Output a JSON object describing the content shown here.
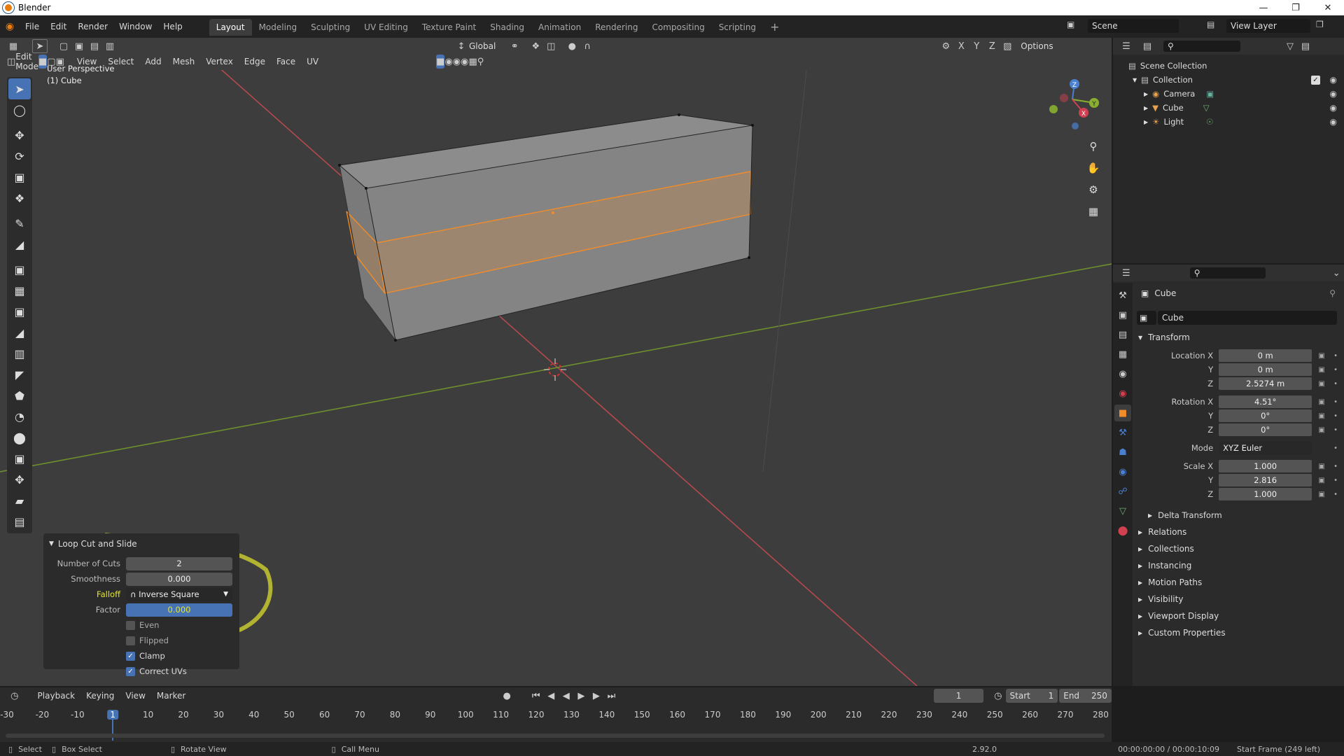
{
  "window": {
    "title": "Blender"
  },
  "menu": [
    "File",
    "Edit",
    "Render",
    "Window",
    "Help"
  ],
  "workspaces": [
    "Layout",
    "Modeling",
    "Sculpting",
    "UV Editing",
    "Texture Paint",
    "Shading",
    "Animation",
    "Rendering",
    "Compositing",
    "Scripting"
  ],
  "active_workspace": "Layout",
  "scene": {
    "label": "Scene",
    "view_layer": "View Layer"
  },
  "viewport": {
    "orientation": "Global",
    "mode": "Edit Mode",
    "menus": [
      "View",
      "Select",
      "Add",
      "Mesh",
      "Vertex",
      "Edge",
      "Face",
      "UV"
    ],
    "options_label": "Options",
    "perspective_label": "User Perspective",
    "object_label": "(1) Cube",
    "gizmo": {
      "x": "X",
      "y": "Y",
      "z": "Z"
    },
    "axis_toggles": [
      "X",
      "Y",
      "Z"
    ]
  },
  "operator_panel": {
    "title": "Loop Cut and Slide",
    "number_of_cuts": {
      "label": "Number of Cuts",
      "value": "2"
    },
    "smoothness": {
      "label": "Smoothness",
      "value": "0.000"
    },
    "falloff": {
      "label": "Falloff",
      "value": "Inverse Square"
    },
    "factor": {
      "label": "Factor",
      "value": "0.000"
    },
    "checkboxes": [
      {
        "label": "Even",
        "checked": false
      },
      {
        "label": "Flipped",
        "checked": false
      },
      {
        "label": "Clamp",
        "checked": true
      },
      {
        "label": "Correct UVs",
        "checked": true
      }
    ]
  },
  "outliner": {
    "root": "Scene Collection",
    "collection": "Collection",
    "items": [
      {
        "label": "Camera",
        "icon": "camera-icon",
        "color": "#e9a24b"
      },
      {
        "label": "Cube",
        "icon": "mesh-icon",
        "color": "#e9a24b"
      },
      {
        "label": "Light",
        "icon": "light-icon",
        "color": "#e9a24b"
      }
    ]
  },
  "properties": {
    "object_name": "Cube",
    "data_name": "Cube",
    "transform_label": "Transform",
    "location": {
      "label": "Location X",
      "x": "0 m",
      "y": "0 m",
      "z": "2.5274 m"
    },
    "rotation": {
      "label": "Rotation X",
      "x": "4.51°",
      "y": "0°",
      "z": "0°"
    },
    "mode": {
      "label": "Mode",
      "value": "XYZ Euler"
    },
    "scale": {
      "label": "Scale X",
      "x": "1.000",
      "y": "2.816",
      "z": "1.000"
    },
    "axis_y": "Y",
    "axis_z": "Z",
    "delta_transform": "Delta Transform",
    "sections": [
      "Relations",
      "Collections",
      "Instancing",
      "Motion Paths",
      "Visibility",
      "Viewport Display",
      "Custom Properties"
    ]
  },
  "timeline": {
    "menus": [
      "Playback",
      "Keying",
      "View",
      "Marker"
    ],
    "current_frame": "1",
    "start_label": "Start",
    "start": "1",
    "end_label": "End",
    "end": "250",
    "ticks": [
      "-30",
      "-20",
      "-10",
      "1",
      "10",
      "20",
      "30",
      "40",
      "50",
      "60",
      "70",
      "80",
      "90",
      "100",
      "110",
      "120",
      "130",
      "140",
      "150",
      "160",
      "170",
      "180",
      "190",
      "200",
      "210",
      "220",
      "230",
      "240",
      "250",
      "260",
      "270",
      "280"
    ]
  },
  "status": {
    "select": "Select",
    "box_select": "Box Select",
    "rotate_view": "Rotate View",
    "call_menu": "Call Menu",
    "version": "2.92.0",
    "time": "00:00:00:00 / 00:00:10:09",
    "start_frame": "Start Frame (249 left)"
  },
  "colors": {
    "accent": "#4772b3",
    "selection": "#f28c28",
    "highlight": "#e6e62e"
  }
}
